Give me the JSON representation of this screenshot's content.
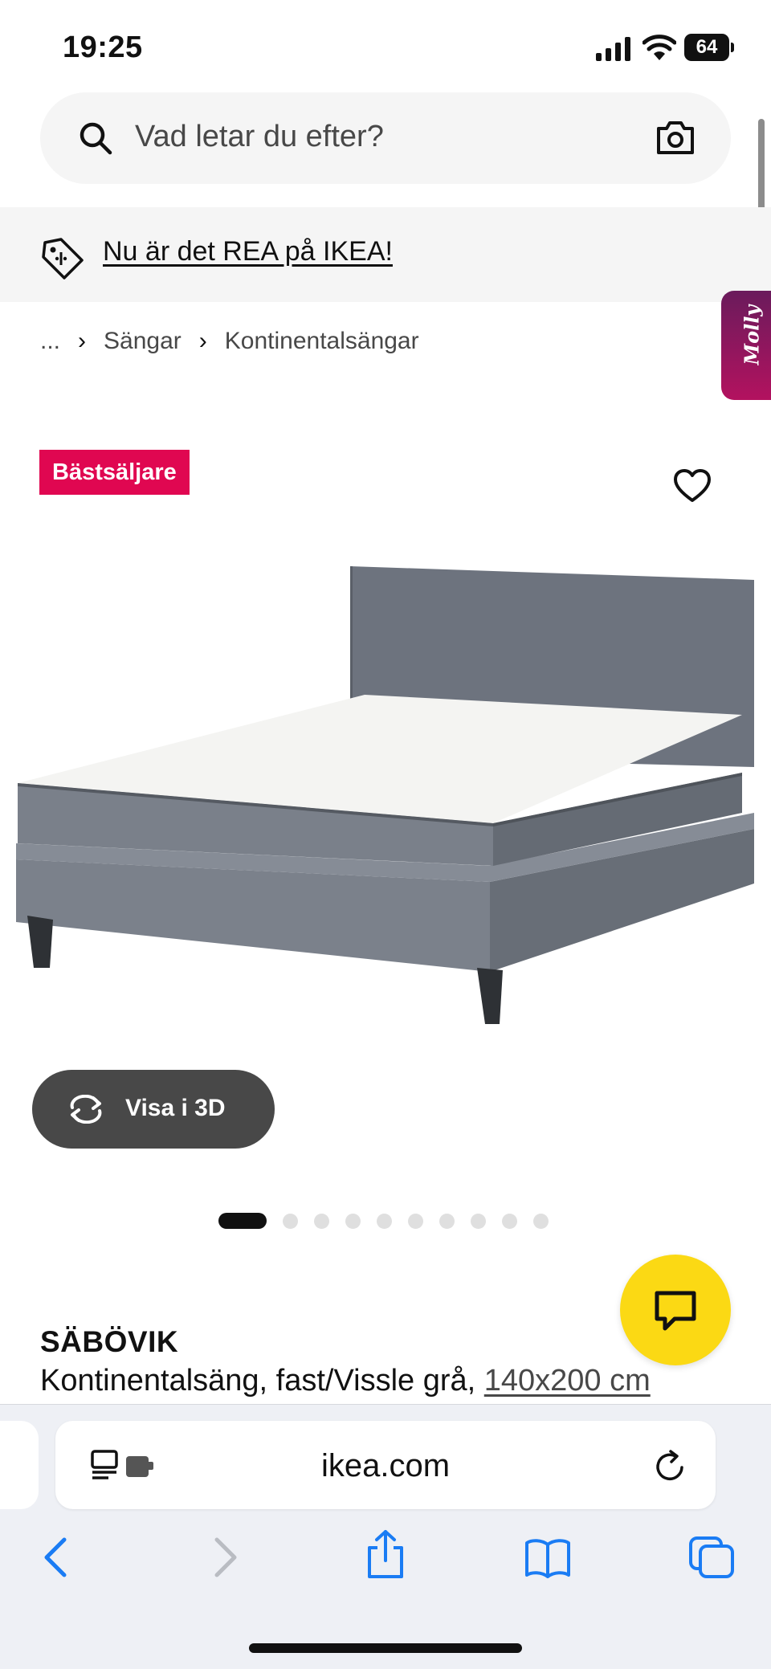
{
  "status_bar": {
    "time": "19:25",
    "battery": "64"
  },
  "search": {
    "placeholder": "Vad letar du efter?"
  },
  "promo": {
    "text": "Nu är det REA på IKEA!"
  },
  "molly": {
    "label": "Molly"
  },
  "breadcrumb": {
    "ellipsis": "...",
    "items": [
      "Sängar",
      "Kontinentalsängar"
    ]
  },
  "product": {
    "badge": "Bästsäljare",
    "name": "SÄBÖVIK",
    "description": "Kontinentalsäng, fast/Vissle grå,",
    "size": "140x200 cm",
    "view3d_label": "Visa i 3D",
    "image_count": 10,
    "active_image": 1
  },
  "browser": {
    "url": "ikea.com"
  },
  "colors": {
    "badge": "#e00751",
    "chat": "#fbd914",
    "molly": "#b3125f",
    "ios_blue": "#1a7cf4"
  }
}
